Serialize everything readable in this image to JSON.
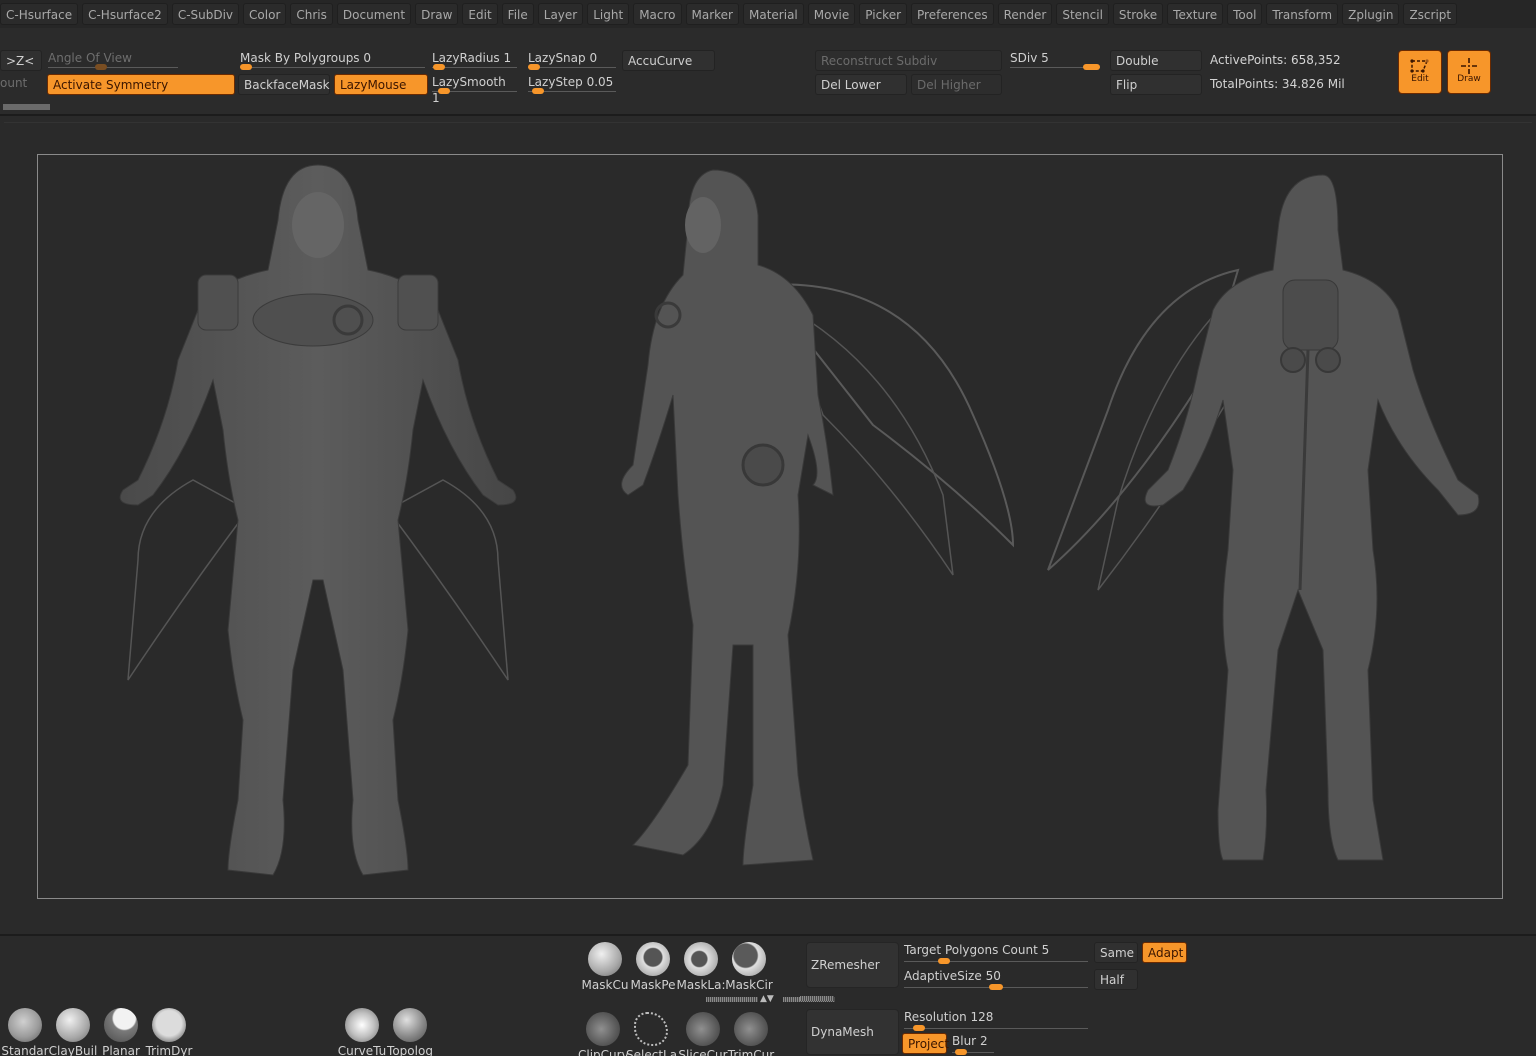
{
  "menu": [
    "C-Hsurface",
    "C-Hsurface2",
    "C-SubDiv",
    "Color",
    "Chris",
    "Document",
    "Draw",
    "Edit",
    "File",
    "Layer",
    "Light",
    "Macro",
    "Marker",
    "Material",
    "Movie",
    "Picker",
    "Preferences",
    "Render",
    "Stencil",
    "Stroke",
    "Texture",
    "Tool",
    "Transform",
    "Zplugin",
    "Zscript"
  ],
  "shelf": {
    "z_axis_btn": ">Z<",
    "angle_of_view": {
      "label": "Angle Of View",
      "value": 0.4
    },
    "count_label": "ount",
    "activate_symmetry": "Activate Symmetry",
    "mask_by_polygroups": {
      "label": "Mask By Polygroups",
      "value": "0",
      "fraction": 0
    },
    "backface_mask": "BackfaceMask",
    "lazy_mouse": "LazyMouse",
    "lazy_radius": {
      "label": "LazyRadius",
      "value": "1",
      "fraction": 0.02
    },
    "lazy_smooth": {
      "label": "LazySmooth",
      "value": "1",
      "fraction": 0.08
    },
    "lazy_snap": {
      "label": "LazySnap",
      "value": "0",
      "fraction": 0
    },
    "lazy_step": {
      "label": "LazyStep",
      "value": "0.05",
      "fraction": 0.05
    },
    "accu_curve": "AccuCurve",
    "reconstruct_subdiv": "Reconstruct Subdiv",
    "del_lower": "Del Lower",
    "del_higher": "Del Higher",
    "sdiv": {
      "label": "SDiv",
      "value": "5",
      "fraction": 1.0
    },
    "double": "Double",
    "flip": "Flip",
    "active_points": "ActivePoints: 658,352",
    "total_points": "TotalPoints: 34.826 Mil",
    "edit_btn": "Edit",
    "draw_btn": "Draw"
  },
  "bottom": {
    "brushes_left": [
      "Standar",
      "ClayBuil",
      "Planar",
      "TrimDyr"
    ],
    "brushes_mid": [
      "CurveTu",
      "Topolog"
    ],
    "mask_brushes": [
      "MaskCu",
      "MaskPe",
      "MaskLa:",
      "MaskCir"
    ],
    "curve_brushes": [
      "ClipCurv",
      "SelectLa",
      "SliceCur",
      "TrimCur"
    ],
    "zremesher": "ZRemesher",
    "target_polygons": {
      "label": "Target Polygons Count",
      "value": "5",
      "fraction": 0.2
    },
    "adaptive_size": {
      "label": "AdaptiveSize",
      "value": "50",
      "fraction": 0.5
    },
    "same": "Same",
    "adapt": "Adapt",
    "half": "Half",
    "dynamesh": "DynaMesh",
    "resolution": {
      "label": "Resolution",
      "value": "128",
      "fraction": 0.05
    },
    "project": "Project",
    "blur": {
      "label": "Blur",
      "value": "2",
      "fraction": 0.1
    }
  },
  "colors": {
    "accent": "#f7962a",
    "background": "#2a2a2a",
    "text": "#c8c8c8"
  }
}
